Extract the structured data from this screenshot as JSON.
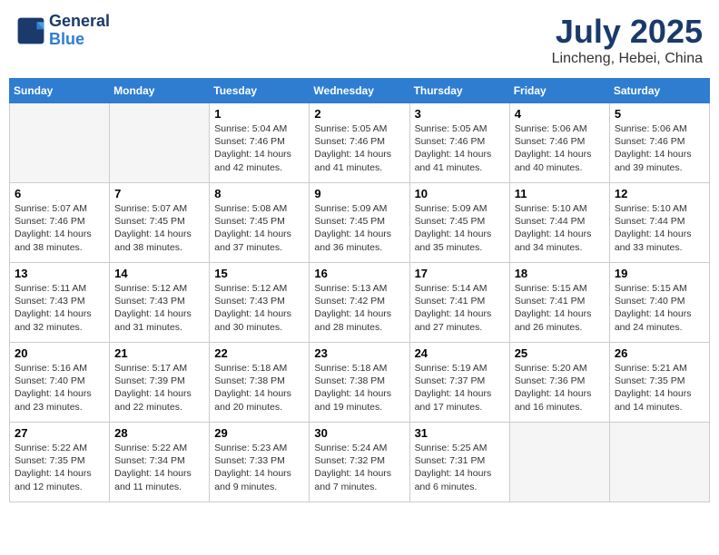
{
  "header": {
    "logo_line1": "General",
    "logo_line2": "Blue",
    "month": "July 2025",
    "location": "Lincheng, Hebei, China"
  },
  "weekdays": [
    "Sunday",
    "Monday",
    "Tuesday",
    "Wednesday",
    "Thursday",
    "Friday",
    "Saturday"
  ],
  "weeks": [
    [
      {
        "day": "",
        "text": ""
      },
      {
        "day": "",
        "text": ""
      },
      {
        "day": "1",
        "text": "Sunrise: 5:04 AM\nSunset: 7:46 PM\nDaylight: 14 hours\nand 42 minutes."
      },
      {
        "day": "2",
        "text": "Sunrise: 5:05 AM\nSunset: 7:46 PM\nDaylight: 14 hours\nand 41 minutes."
      },
      {
        "day": "3",
        "text": "Sunrise: 5:05 AM\nSunset: 7:46 PM\nDaylight: 14 hours\nand 41 minutes."
      },
      {
        "day": "4",
        "text": "Sunrise: 5:06 AM\nSunset: 7:46 PM\nDaylight: 14 hours\nand 40 minutes."
      },
      {
        "day": "5",
        "text": "Sunrise: 5:06 AM\nSunset: 7:46 PM\nDaylight: 14 hours\nand 39 minutes."
      }
    ],
    [
      {
        "day": "6",
        "text": "Sunrise: 5:07 AM\nSunset: 7:46 PM\nDaylight: 14 hours\nand 38 minutes."
      },
      {
        "day": "7",
        "text": "Sunrise: 5:07 AM\nSunset: 7:45 PM\nDaylight: 14 hours\nand 38 minutes."
      },
      {
        "day": "8",
        "text": "Sunrise: 5:08 AM\nSunset: 7:45 PM\nDaylight: 14 hours\nand 37 minutes."
      },
      {
        "day": "9",
        "text": "Sunrise: 5:09 AM\nSunset: 7:45 PM\nDaylight: 14 hours\nand 36 minutes."
      },
      {
        "day": "10",
        "text": "Sunrise: 5:09 AM\nSunset: 7:45 PM\nDaylight: 14 hours\nand 35 minutes."
      },
      {
        "day": "11",
        "text": "Sunrise: 5:10 AM\nSunset: 7:44 PM\nDaylight: 14 hours\nand 34 minutes."
      },
      {
        "day": "12",
        "text": "Sunrise: 5:10 AM\nSunset: 7:44 PM\nDaylight: 14 hours\nand 33 minutes."
      }
    ],
    [
      {
        "day": "13",
        "text": "Sunrise: 5:11 AM\nSunset: 7:43 PM\nDaylight: 14 hours\nand 32 minutes."
      },
      {
        "day": "14",
        "text": "Sunrise: 5:12 AM\nSunset: 7:43 PM\nDaylight: 14 hours\nand 31 minutes."
      },
      {
        "day": "15",
        "text": "Sunrise: 5:12 AM\nSunset: 7:43 PM\nDaylight: 14 hours\nand 30 minutes."
      },
      {
        "day": "16",
        "text": "Sunrise: 5:13 AM\nSunset: 7:42 PM\nDaylight: 14 hours\nand 28 minutes."
      },
      {
        "day": "17",
        "text": "Sunrise: 5:14 AM\nSunset: 7:41 PM\nDaylight: 14 hours\nand 27 minutes."
      },
      {
        "day": "18",
        "text": "Sunrise: 5:15 AM\nSunset: 7:41 PM\nDaylight: 14 hours\nand 26 minutes."
      },
      {
        "day": "19",
        "text": "Sunrise: 5:15 AM\nSunset: 7:40 PM\nDaylight: 14 hours\nand 24 minutes."
      }
    ],
    [
      {
        "day": "20",
        "text": "Sunrise: 5:16 AM\nSunset: 7:40 PM\nDaylight: 14 hours\nand 23 minutes."
      },
      {
        "day": "21",
        "text": "Sunrise: 5:17 AM\nSunset: 7:39 PM\nDaylight: 14 hours\nand 22 minutes."
      },
      {
        "day": "22",
        "text": "Sunrise: 5:18 AM\nSunset: 7:38 PM\nDaylight: 14 hours\nand 20 minutes."
      },
      {
        "day": "23",
        "text": "Sunrise: 5:18 AM\nSunset: 7:38 PM\nDaylight: 14 hours\nand 19 minutes."
      },
      {
        "day": "24",
        "text": "Sunrise: 5:19 AM\nSunset: 7:37 PM\nDaylight: 14 hours\nand 17 minutes."
      },
      {
        "day": "25",
        "text": "Sunrise: 5:20 AM\nSunset: 7:36 PM\nDaylight: 14 hours\nand 16 minutes."
      },
      {
        "day": "26",
        "text": "Sunrise: 5:21 AM\nSunset: 7:35 PM\nDaylight: 14 hours\nand 14 minutes."
      }
    ],
    [
      {
        "day": "27",
        "text": "Sunrise: 5:22 AM\nSunset: 7:35 PM\nDaylight: 14 hours\nand 12 minutes."
      },
      {
        "day": "28",
        "text": "Sunrise: 5:22 AM\nSunset: 7:34 PM\nDaylight: 14 hours\nand 11 minutes."
      },
      {
        "day": "29",
        "text": "Sunrise: 5:23 AM\nSunset: 7:33 PM\nDaylight: 14 hours\nand 9 minutes."
      },
      {
        "day": "30",
        "text": "Sunrise: 5:24 AM\nSunset: 7:32 PM\nDaylight: 14 hours\nand 7 minutes."
      },
      {
        "day": "31",
        "text": "Sunrise: 5:25 AM\nSunset: 7:31 PM\nDaylight: 14 hours\nand 6 minutes."
      },
      {
        "day": "",
        "text": ""
      },
      {
        "day": "",
        "text": ""
      }
    ]
  ]
}
